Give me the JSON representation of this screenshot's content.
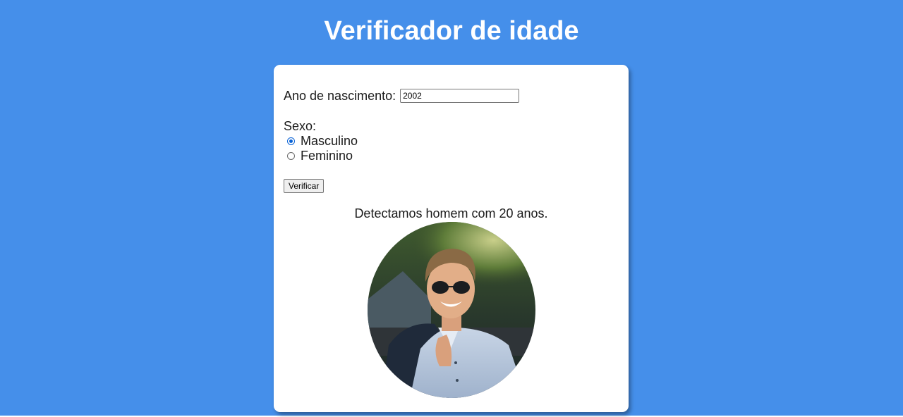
{
  "page": {
    "title": "Verificador de idade",
    "background_color": "#458fea"
  },
  "form": {
    "year_label": "Ano de nascimento:",
    "year_value": "2002",
    "sex_label": "Sexo:",
    "sex_options": [
      {
        "label": "Masculino",
        "checked": true
      },
      {
        "label": "Feminino",
        "checked": false
      }
    ],
    "verify_button": "Verificar"
  },
  "result": {
    "text": "Detectamos homem com 20 anos.",
    "photo_icon": "man-with-sunglasses-photo"
  }
}
